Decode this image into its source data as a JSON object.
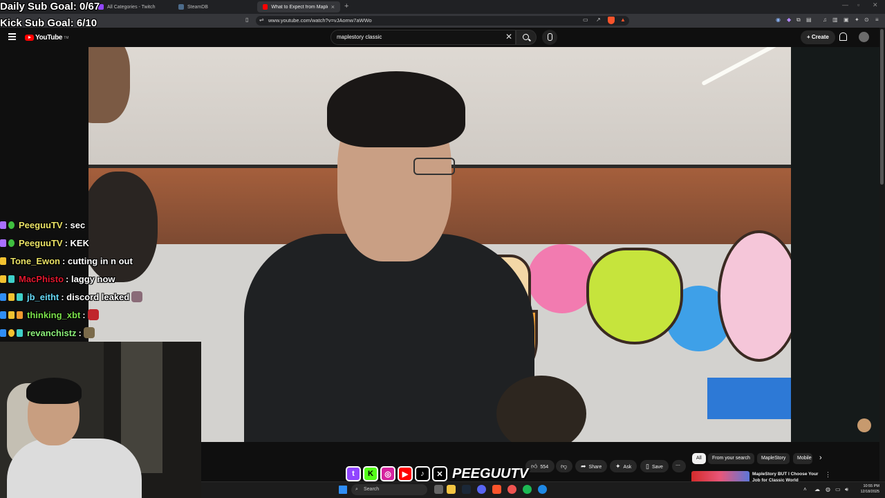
{
  "overlay": {
    "daily_goal": "Daily Sub Goal: 0/67",
    "kick_goal": "Kick Sub Goal: 6/10"
  },
  "browser": {
    "tabs": [
      {
        "title": "All Categories - Twitch",
        "active": false
      },
      {
        "title": "SteamDB",
        "active": false
      },
      {
        "title": "What to Expect from MapleStory",
        "active": true
      }
    ],
    "url": "www.youtube.com/watch?v=vJAomw7aWWo"
  },
  "youtube": {
    "logo_text": "YouTube",
    "logo_sup": "TM",
    "search_value": "maplestory classic",
    "create_label": "Create",
    "likes": "554",
    "share_label": "Share",
    "ask_label": "Ask",
    "save_label": "Save",
    "chips": [
      "All",
      "From your search",
      "MapleStory",
      "Mobile"
    ],
    "rec_title": "MapleStory BUT I Choose Your Job for Classic World"
  },
  "chat": [
    {
      "user": "PeeguuTV",
      "color": "#e8e065",
      "text": ": sec",
      "emote": false
    },
    {
      "user": "PeeguuTV",
      "color": "#e8e065",
      "text": ": KEK",
      "emote": false
    },
    {
      "user": "Tone_Ewon",
      "color": "#e8e065",
      "text": ": cutting in n out",
      "emote": false
    },
    {
      "user": "MacPhisto",
      "color": "#e0182e",
      "text": ": laggy now",
      "emote": false
    },
    {
      "user": "jb_eitht",
      "color": "#66d8f4",
      "text": ": discord leaked",
      "emote": true
    },
    {
      "user": "thinking_xbt",
      "color": "#7ae04a",
      "text": ":",
      "emote": true
    },
    {
      "user": "revanchistz",
      "color": "#8cf07a",
      "text": ":",
      "emote": true
    }
  ],
  "social": {
    "brand": "PEEGUUTV",
    "icons": [
      "twitch-icon",
      "kick-icon",
      "instagram-icon",
      "youtube-icon",
      "tiktok-icon",
      "x-icon"
    ]
  },
  "taskbar": {
    "search_placeholder": "Search",
    "time": "10:55 PM",
    "date": "12/18/2025"
  },
  "colors": {
    "yt_red": "#ff0000",
    "yt_bg": "#0f0f0f",
    "chip_bg": "#272727",
    "brave_orange": "#fb542b"
  }
}
